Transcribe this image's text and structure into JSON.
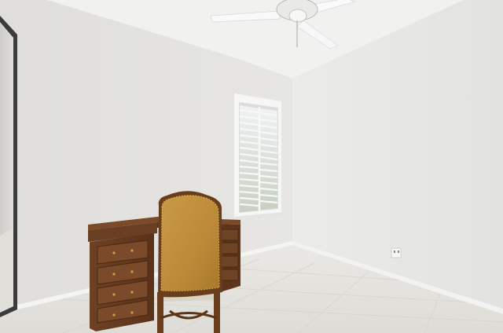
{
  "scene": {
    "kind": "photo",
    "subject": "empty-bedroom-with-desk-and-chair",
    "objects": [
      "ceiling-fan",
      "window-with-plantation-shutters",
      "wooden-desk",
      "leather-upholstered-chair",
      "mirrored-closet-door",
      "electrical-outlet",
      "tile-floor",
      "baseboard"
    ]
  },
  "colors": {
    "ceiling": "#f2f2f0",
    "wall_left": "#e6e5e2",
    "wall_right": "#e8e8e6",
    "floor": "#e7e6e2",
    "desk": "#6d3f22",
    "chair_upholstery": "#c08f3c",
    "chair_frame": "#6a3d1d",
    "window_frame": "#f4f4f2",
    "shutters": "#ececec"
  }
}
